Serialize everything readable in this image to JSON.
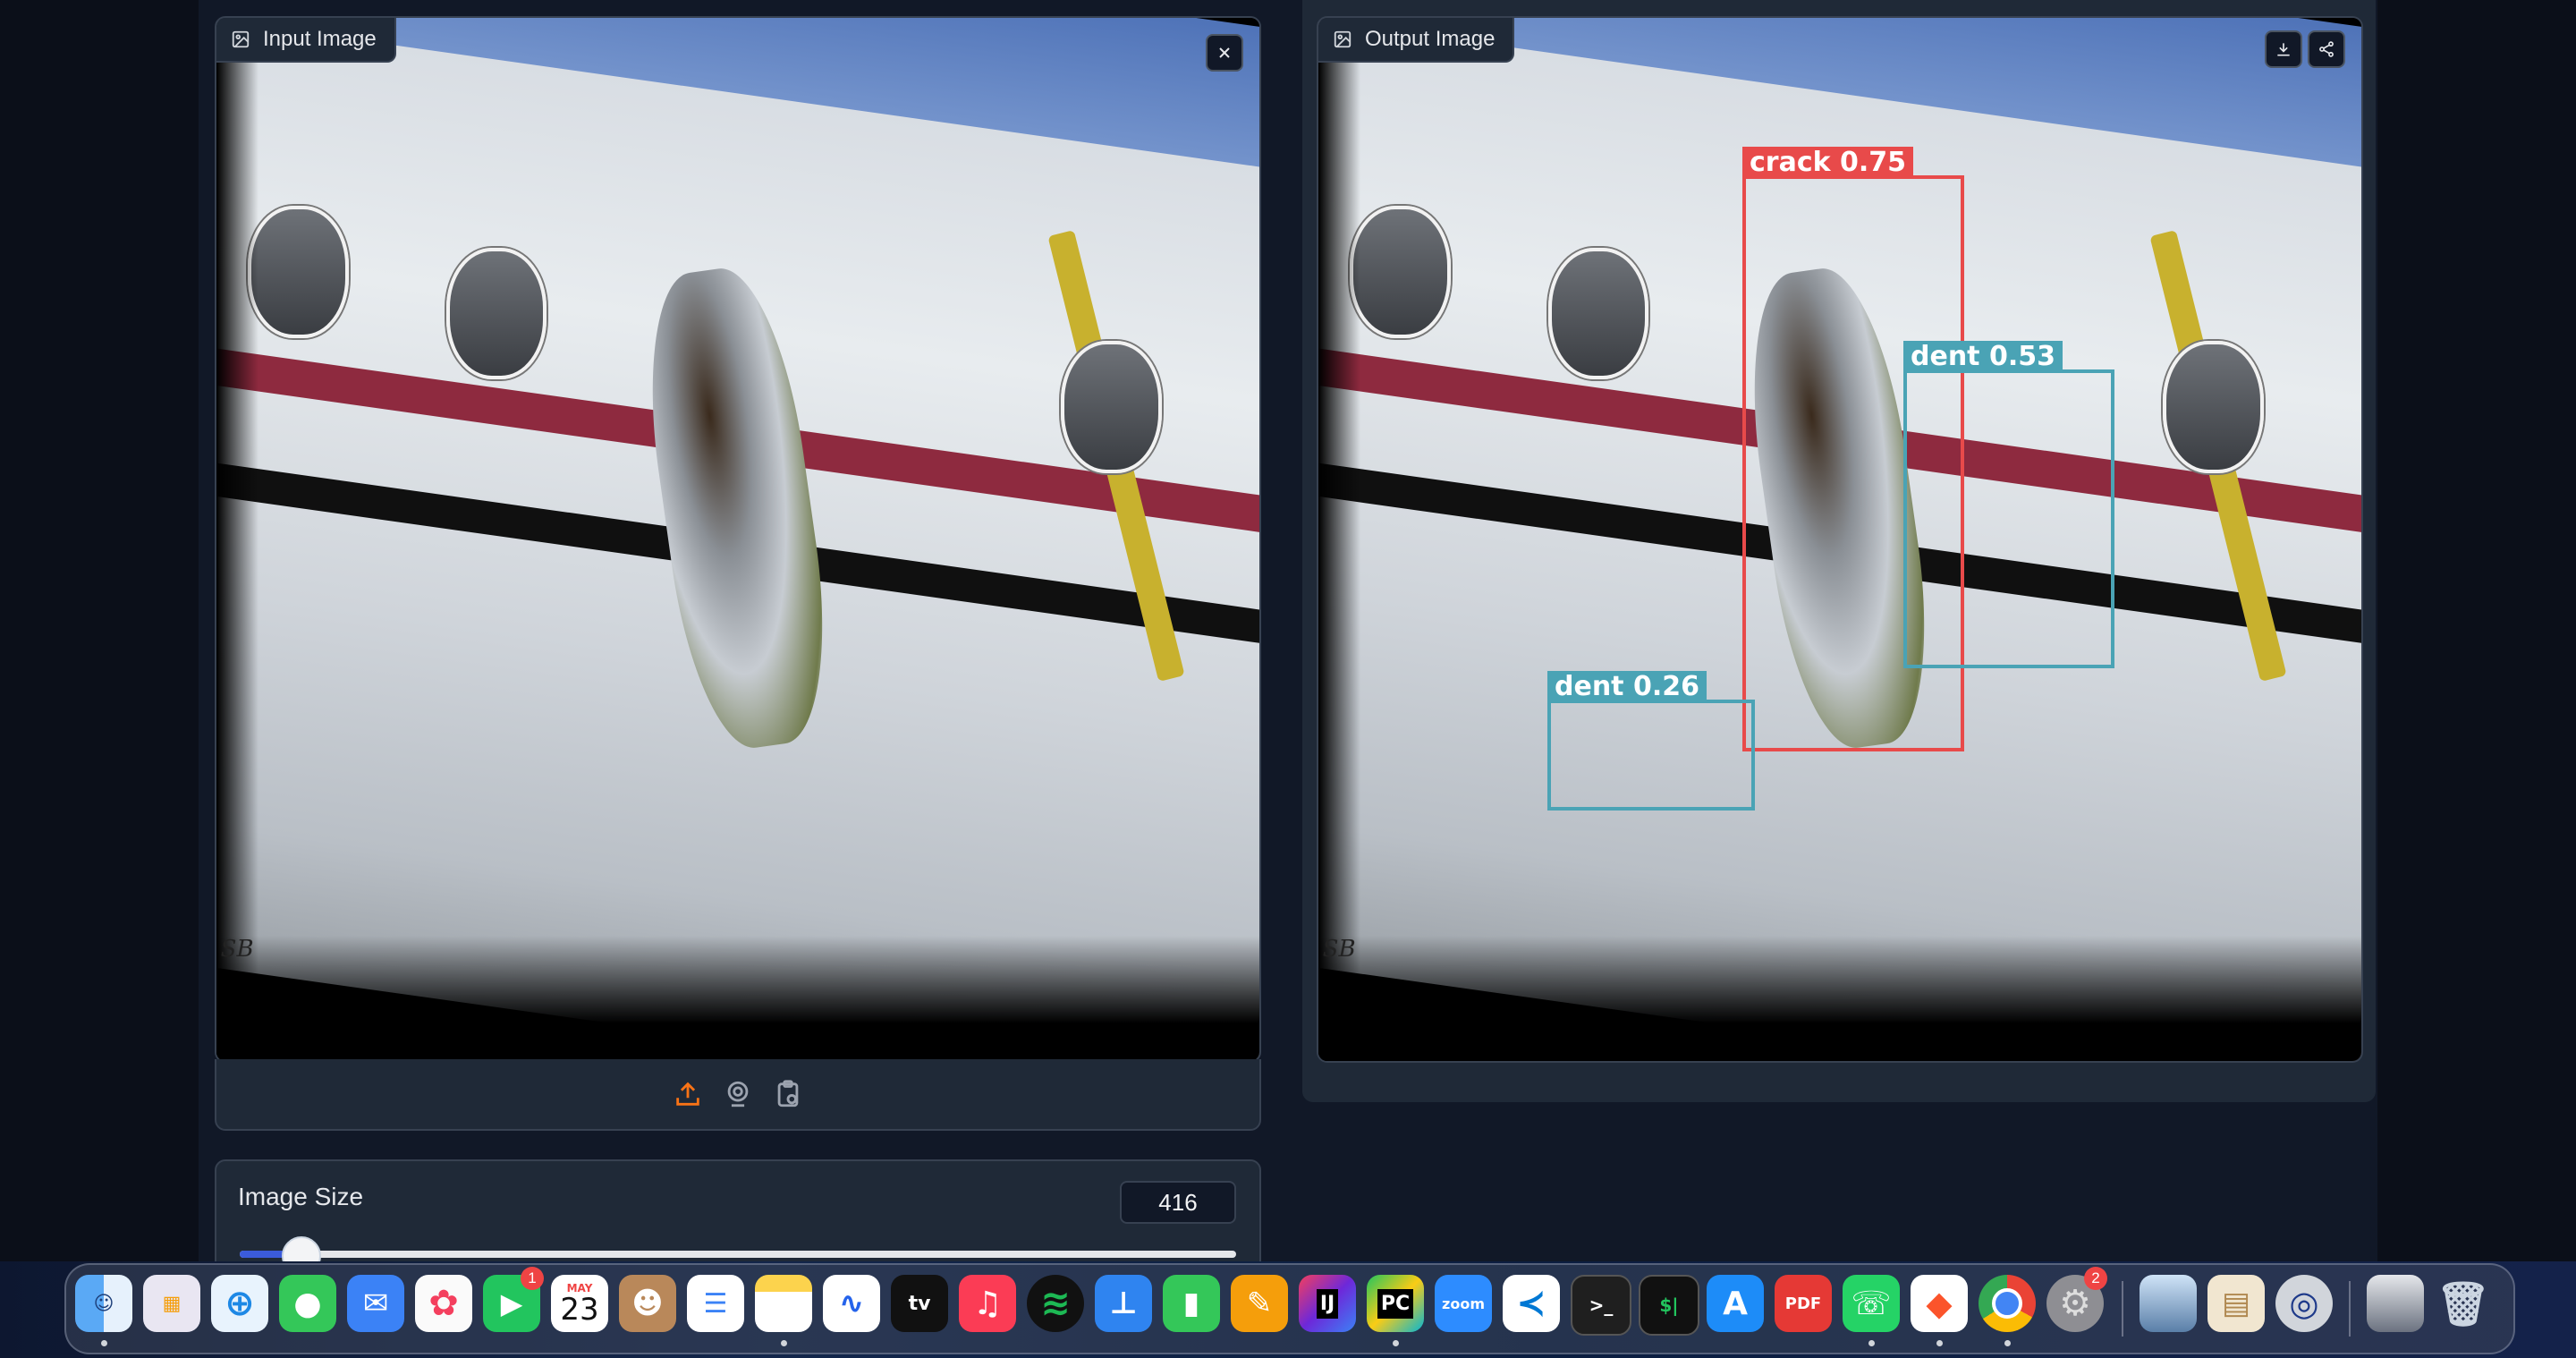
{
  "input_panel": {
    "label": "Input Image",
    "close_icon": "close-icon",
    "watermark": "SB",
    "toolbar_icons": [
      "upload-icon",
      "webcam-icon",
      "clipboard-icon"
    ]
  },
  "output_panel": {
    "label": "Output Image",
    "download_icon": "download-icon",
    "share_icon": "share-icon",
    "watermark": "SB",
    "detections": [
      {
        "label": "crack 0.75",
        "class": "crack",
        "confidence": 0.75,
        "color": "#e84a4a"
      },
      {
        "label": "dent 0.53",
        "class": "dent",
        "confidence": 0.53,
        "color": "#4aa3b5"
      },
      {
        "label": "dent 0.26",
        "class": "dent",
        "confidence": 0.26,
        "color": "#4aa3b5"
      }
    ]
  },
  "image_size": {
    "label": "Image Size",
    "value": "416",
    "slider_fraction": 0.06
  },
  "dock": {
    "calendar_month": "MAY",
    "calendar_day": "23",
    "facetime_badge": "1",
    "settings_badge": "2",
    "apps": [
      "Finder",
      "Launchpad",
      "Safari",
      "Messages",
      "Mail",
      "Photos",
      "FaceTime",
      "Calendar",
      "Contacts",
      "Reminders",
      "Notes",
      "Freeform",
      "Apple TV",
      "Music",
      "Spotify",
      "Keynote",
      "Numbers",
      "Pages",
      "IntelliJ IDEA",
      "PyCharm",
      "Zoom",
      "VS Code",
      "Terminal",
      "iTerm",
      "App Store",
      "PDF Expert",
      "WhatsApp",
      "Brave",
      "Chrome",
      "System Settings",
      "Preview",
      "Archive Utility",
      "QuickTime",
      "Downloads",
      "Trash"
    ],
    "tv_label": "tv",
    "zoom_label": "zoom",
    "pdf_label": "PDF",
    "ij_label": "IJ",
    "pc_label": "PC"
  }
}
